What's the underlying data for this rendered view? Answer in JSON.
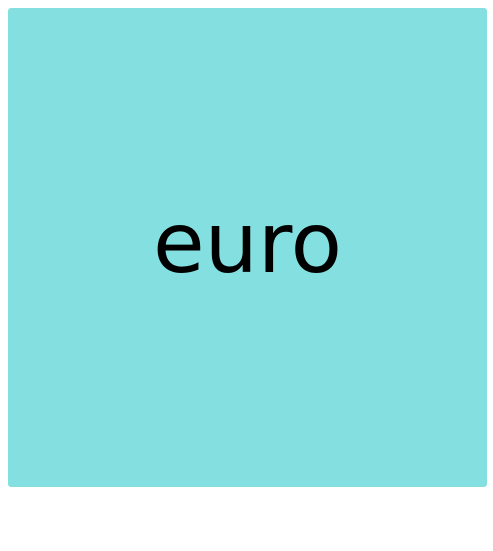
{
  "card": {
    "label": "euro",
    "background_color": "#84e0e0",
    "text_color": "#000000"
  },
  "page": {
    "background_color": "#ffffff"
  }
}
